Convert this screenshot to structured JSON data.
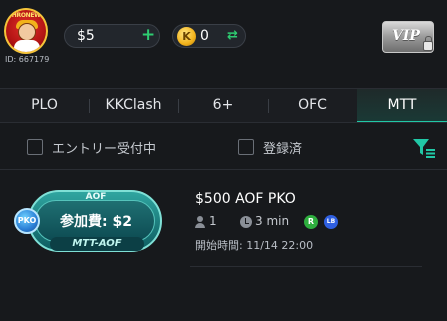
{
  "header": {
    "avatar_icon": "avatar-king-icon",
    "avatar_ring_text": "THRONEWEEK",
    "user_id": "ID: 667179",
    "balance": "$5",
    "balance_add_icon": "plus-icon",
    "coin_icon": "coin-k-icon",
    "coin_letter": "K",
    "coins": "0",
    "coin_exchange_icon": "swap-arrows-icon",
    "vip_label": "VIP",
    "vip_icon": "lock-icon"
  },
  "tabs": [
    {
      "label": "PLO",
      "active": false
    },
    {
      "label": "KKClash",
      "active": false
    },
    {
      "label": "6+",
      "active": false
    },
    {
      "label": "OFC",
      "active": false
    },
    {
      "label": "MTT",
      "active": true
    }
  ],
  "filters": {
    "entry_open_label": "エントリー受付中",
    "entry_open_checked": false,
    "registered_label": "登録済",
    "registered_checked": false,
    "filter_icon": "filter-icon"
  },
  "tournament": {
    "badge_top": "AOF",
    "badge_fee": "参加費: $2",
    "badge_bottom": "MTT-AOF",
    "pko_label": "PKO",
    "name": "$500 AOF PKO",
    "players": "1",
    "duration": "3 min",
    "r_label": "R",
    "lb_label": "LB",
    "start_time": "開始時間: 11/14 22:00"
  },
  "colors": {
    "accent": "#21c8a6",
    "background": "#17191c",
    "positive": "#2ecc71"
  }
}
